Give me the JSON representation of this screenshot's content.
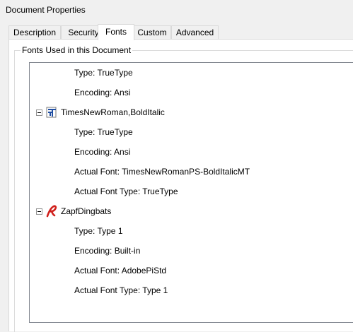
{
  "window": {
    "title": "Document Properties"
  },
  "tabs": [
    {
      "label": "Description"
    },
    {
      "label": "Security"
    },
    {
      "label": "Fonts"
    },
    {
      "label": "Custom"
    },
    {
      "label": "Advanced"
    }
  ],
  "active_tab": "Fonts",
  "group": {
    "label": "Fonts Used in this Document"
  },
  "font_tree": {
    "rows": [
      {
        "kind": "property",
        "text": "Type: TrueType"
      },
      {
        "kind": "property",
        "text": "Encoding: Ansi"
      },
      {
        "kind": "font",
        "name": "TimesNewRoman,BoldItalic",
        "icon": "truetype-font-icon"
      },
      {
        "kind": "property",
        "text": "Type: TrueType"
      },
      {
        "kind": "property",
        "text": "Encoding: Ansi"
      },
      {
        "kind": "property",
        "text": "Actual Font: TimesNewRomanPS-BoldItalicMT"
      },
      {
        "kind": "property",
        "text": "Actual Font Type: TrueType"
      },
      {
        "kind": "font",
        "name": "ZapfDingbats",
        "icon": "type1-font-icon"
      },
      {
        "kind": "property",
        "text": "Type: Type 1"
      },
      {
        "kind": "property",
        "text": "Encoding: Built-in"
      },
      {
        "kind": "property",
        "text": "Actual Font: AdobePiStd"
      },
      {
        "kind": "property",
        "text": "Actual Font Type: Type 1"
      }
    ]
  },
  "colors": {
    "window_bg": "#f0f0f0",
    "panel_bg": "#ffffff",
    "truetype_icon": "#1f4ea3",
    "type1_icon": "#d0201c"
  }
}
